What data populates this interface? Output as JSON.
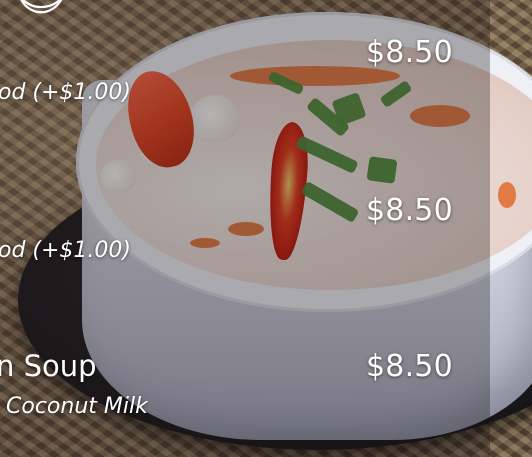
{
  "menu": {
    "items": [
      {
        "price": "$8.50",
        "addon": "od (+$1.00)"
      },
      {
        "price": "$8.50",
        "addon": "od (+$1.00)"
      },
      {
        "name": "n Soup",
        "price": "$8.50",
        "description": "Coconut Milk"
      }
    ]
  },
  "icons": {
    "top_left": "moon-icon"
  },
  "colors": {
    "text": "#ffffff",
    "overlay": "#191416"
  }
}
